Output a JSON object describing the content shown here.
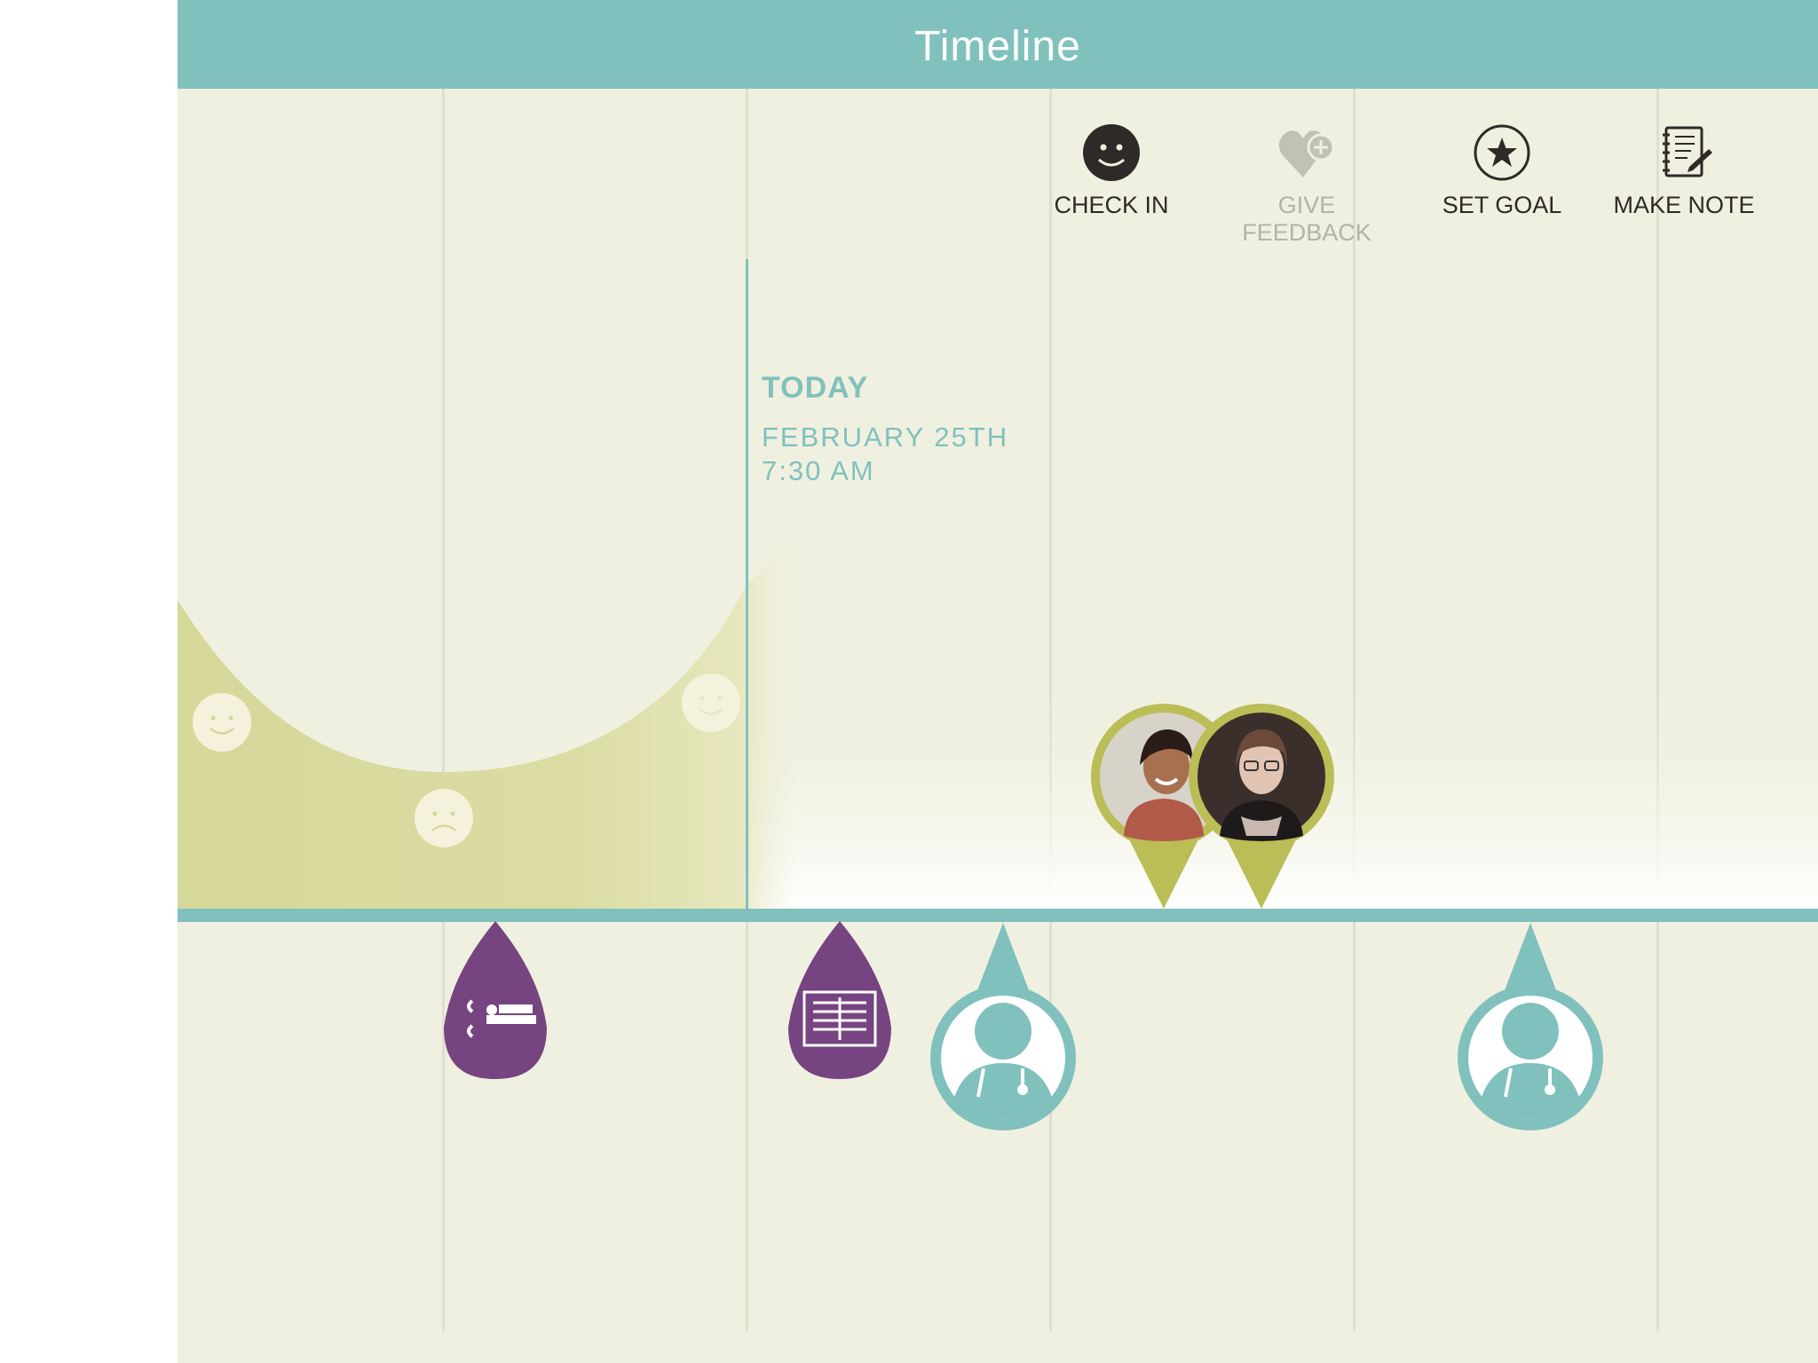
{
  "header": {
    "title": "Timeline"
  },
  "actions": [
    {
      "label": "CHECK IN",
      "icon": "smiley-icon",
      "enabled": true
    },
    {
      "label": "GIVE FEEDBACK",
      "icon": "heart-plus-icon",
      "enabled": false
    },
    {
      "label": "SET GOAL",
      "icon": "star-circle-icon",
      "enabled": true
    },
    {
      "label": "MAKE NOTE",
      "icon": "notebook-pencil-icon",
      "enabled": true
    }
  ],
  "today": {
    "label": "TODAY",
    "date": "FEBRUARY 25TH",
    "time": "7:30 AM"
  },
  "mood_markers": [
    "happy-face-icon",
    "sad-face-icon",
    "happy-face-icon"
  ],
  "events": [
    {
      "type": "procedure",
      "icon": "patient-bed-icon"
    },
    {
      "type": "imaging",
      "icon": "xray-icon"
    },
    {
      "type": "doctor-visit",
      "icon": "doctor-icon"
    },
    {
      "type": "doctor-visit",
      "icon": "doctor-icon"
    }
  ],
  "care_team": [
    "avatar-photo",
    "avatar-photo"
  ],
  "colors": {
    "header": "#80c1bd",
    "background": "#f0f0e0",
    "mood_area": "#d6d89a",
    "procedure_pin": "#764480",
    "doctor_pin": "#80c1bd",
    "photo_pin": "#bbbd56",
    "text_dark": "#2e2a27"
  }
}
